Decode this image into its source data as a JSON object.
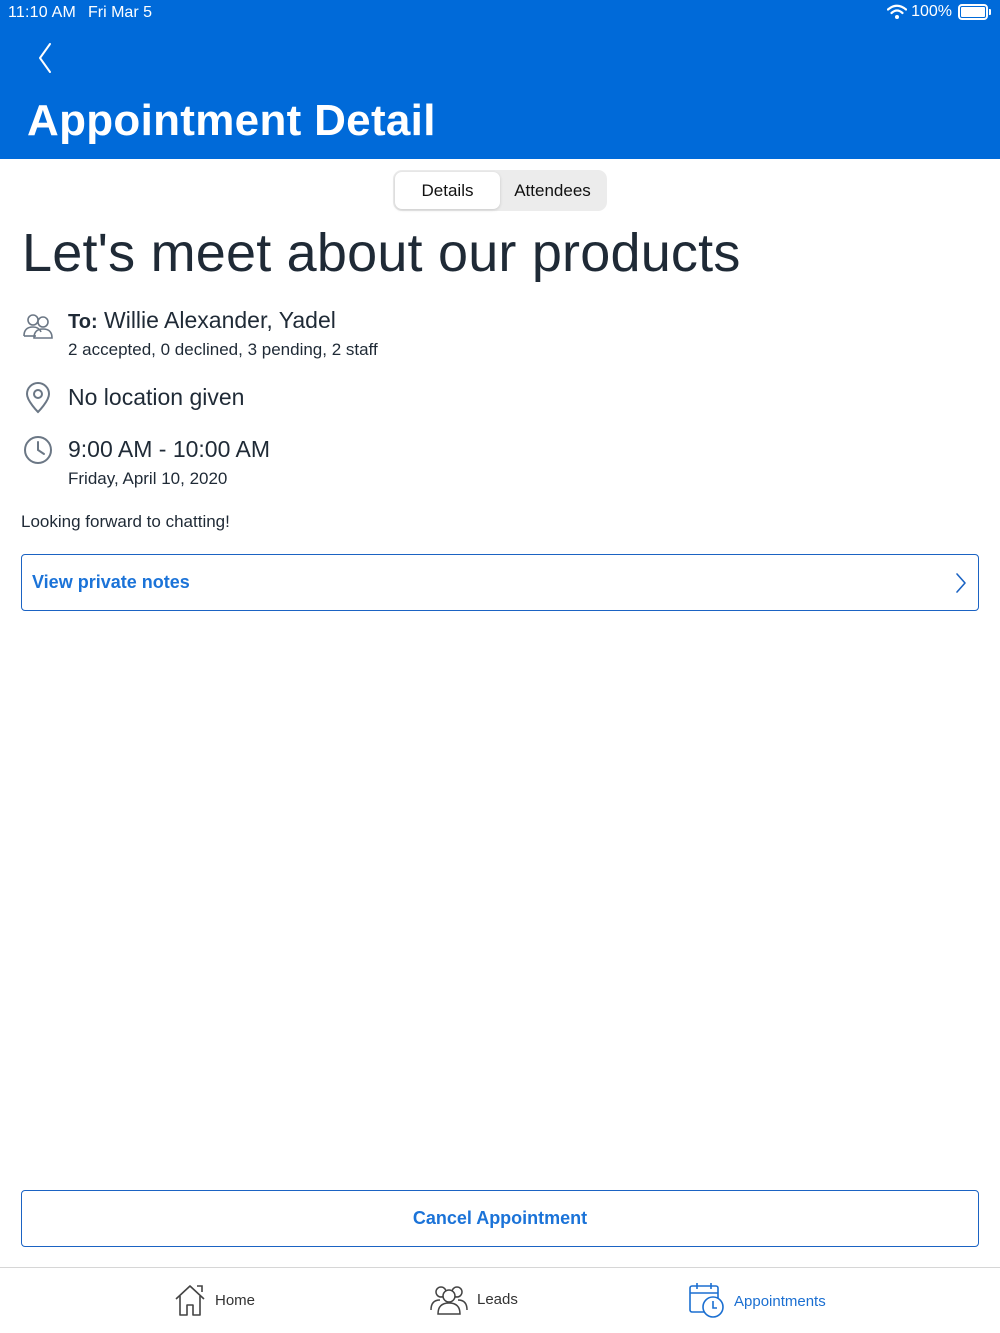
{
  "status_bar": {
    "time": "11:10 AM",
    "date": "Fri Mar 5",
    "battery": "100%"
  },
  "header": {
    "title": "Appointment Detail",
    "background_color": "#006ad9"
  },
  "segments": {
    "details": "Details",
    "attendees": "Attendees",
    "selected": "Details"
  },
  "appointment": {
    "title": "Let's meet about our products",
    "to_label": "To:",
    "to_names": "Willie Alexander, Yadel",
    "attendance_summary": "2 accepted, 0 declined, 3 pending, 2 staff",
    "location": "No location given",
    "time_range": "9:00 AM - 10:00 AM",
    "date": "Friday, April 10, 2020",
    "description": "Looking forward to chatting!"
  },
  "actions": {
    "view_notes": "View private notes",
    "cancel": "Cancel Appointment",
    "accent_color": "#1b73d8"
  },
  "tab_bar": {
    "home": "Home",
    "leads": "Leads",
    "appointments": "Appointments",
    "active": "Appointments"
  }
}
